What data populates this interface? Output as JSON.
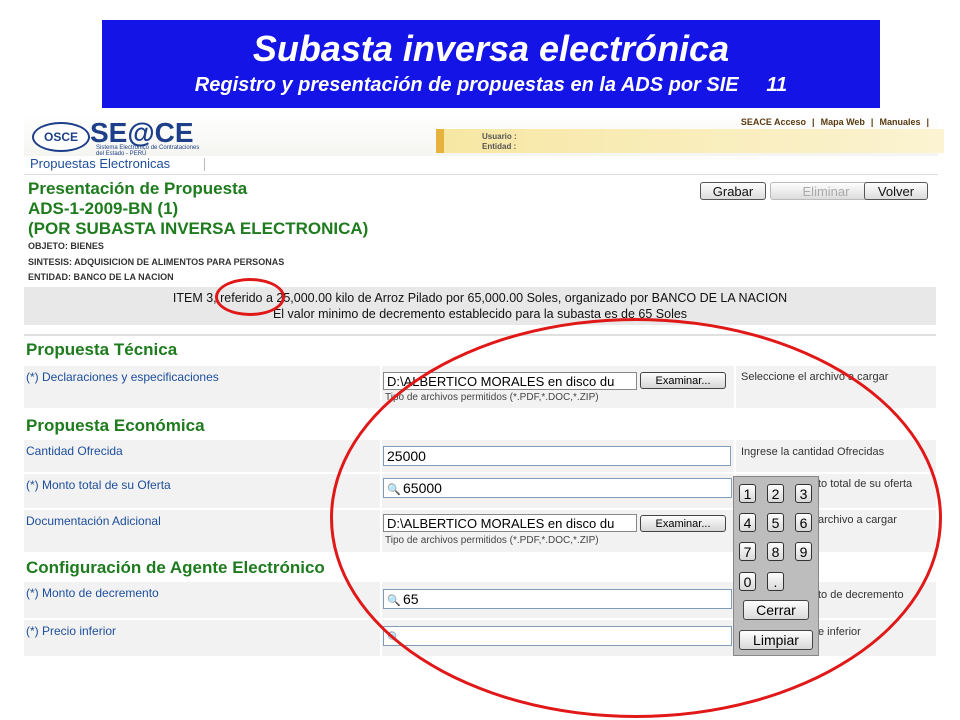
{
  "banner": {
    "title": "Subasta inversa electrónica",
    "subtitle": "Registro y presentación de propuestas en la ADS por SIE     11"
  },
  "header": {
    "logo_osce": "OSCE",
    "logo_seace": "SE@CE",
    "logo_sub1": "Sistema Electrónico de Contrataciones",
    "logo_sub2": "del Estado - PERÚ",
    "links": [
      "SEACE Acceso",
      "|",
      "Mapa Web",
      "|",
      "Manuales",
      "|"
    ],
    "usuario_label": "Usuario :",
    "entidad_label": "Entidad :"
  },
  "tab": {
    "label": "Propuestas Electronicas"
  },
  "presentation": {
    "title": "Presentación de Propuesta",
    "code": "ADS-1-2009-BN (1)",
    "type": "(POR SUBASTA INVERSA ELECTRONICA)",
    "objeto": "OBJETO: BIENES",
    "sintesis": "SINTESIS: ADQUISICION DE ALIMENTOS PARA PERSONAS",
    "entidad": "ENTIDAD: BANCO DE LA NACION"
  },
  "actions": {
    "save": "Grabar",
    "delete": "Eliminar",
    "back": "Volver"
  },
  "item": {
    "line1": "ITEM 3, referido a 25,000.00 kilo de Arroz Pilado  por 65,000.00 Soles, organizado por BANCO DE LA NACION",
    "line2": "El valor minimo de decremento establecido para la subasta es de 65 Soles"
  },
  "tecnica": {
    "section": "Propuesta Técnica",
    "decl_label": "(*) Declaraciones y especificaciones",
    "decl_value": "D:\\ALBERTICO MORALES en disco du",
    "browse": "Examinar...",
    "decl_hint": "Seleccione el archivo a cargar",
    "file_types": "Tipo de archivos permitidos (*.PDF,*.DOC,*.ZIP)"
  },
  "economica": {
    "section": "Propuesta Económica",
    "cantidad_label": "Cantidad Ofrecida",
    "cantidad_value": "25000",
    "cantidad_hint": "Ingrese la cantidad Ofrecidas",
    "monto_label": "(*) Monto total de su Oferta",
    "monto_value": "65000",
    "monto_hint": "to total de su oferta",
    "doc_label": "Documentación Adicional",
    "doc_value": "D:\\ALBERTICO MORALES en disco du",
    "doc_browse": "Examinar...",
    "doc_hint": "archivo a cargar",
    "doc_types": "Tipo de archivos permitidos (*.PDF,*.DOC,*.ZIP)"
  },
  "agente": {
    "section": "Configuración de Agente Electrónico",
    "decremento_label": "(*) Monto de decremento",
    "decremento_value": "65",
    "decremento_hint": "to de decremento",
    "precio_label": "(*) Precio inferior",
    "precio_value": "",
    "precio_hint": "e inferior"
  },
  "keypad": {
    "keys": [
      "1",
      "2",
      "3",
      "4",
      "5",
      "6",
      "7",
      "8",
      "9",
      "0",
      "."
    ],
    "close": "Cerrar",
    "clear": "Limpiar"
  },
  "colors": {
    "banner": "#1414e6",
    "section": "#1e7b1e",
    "label": "#1d4e9b",
    "annotation": "#e01818"
  },
  "icons": {
    "search": "search-icon"
  }
}
